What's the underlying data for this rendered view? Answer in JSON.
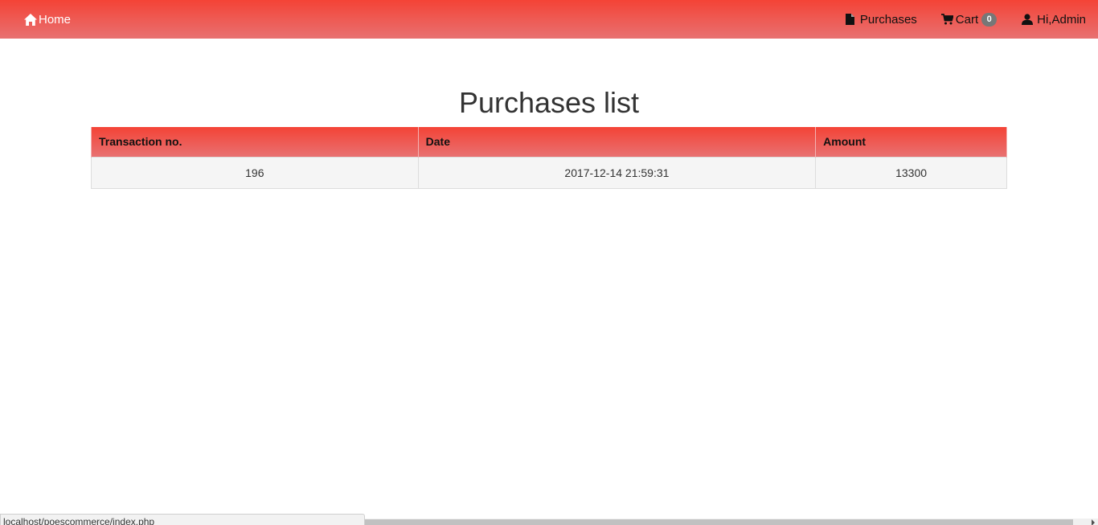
{
  "navbar": {
    "home_label": "Home",
    "home_icon": "home-icon",
    "purchases_label": "Purchases",
    "purchases_icon": "file-icon",
    "cart_label": "Cart",
    "cart_icon": "shopping-cart-icon",
    "cart_count": "0",
    "user_label": "Hi,Admin",
    "user_icon": "user-icon",
    "gradient_top": "#f44336",
    "gradient_bottom": "#e87171"
  },
  "page": {
    "title": "Purchases list"
  },
  "table": {
    "headers": [
      "Transaction no.",
      "Date",
      "Amount"
    ],
    "rows": [
      [
        "196",
        "2017-12-14 21:59:31",
        "13300"
      ]
    ]
  },
  "status_bar": {
    "url": "localhost/poescommerce/index.php"
  }
}
